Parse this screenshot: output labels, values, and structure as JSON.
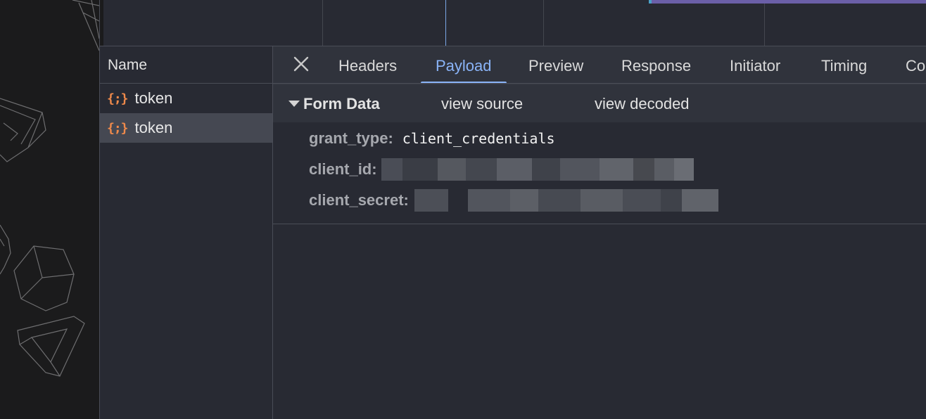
{
  "network": {
    "name_column_header": "Name",
    "requests": [
      {
        "icon": "json-braces-icon",
        "glyph": "{;}",
        "name": "token",
        "selected": false
      },
      {
        "icon": "json-braces-icon",
        "glyph": "{;}",
        "name": "token",
        "selected": true
      }
    ]
  },
  "detail": {
    "tabs": [
      {
        "label": "Headers",
        "active": false
      },
      {
        "label": "Payload",
        "active": true
      },
      {
        "label": "Preview",
        "active": false
      },
      {
        "label": "Response",
        "active": false
      },
      {
        "label": "Initiator",
        "active": false
      },
      {
        "label": "Timing",
        "active": false
      },
      {
        "label": "Co",
        "active": false
      }
    ],
    "close_icon": "close-icon",
    "form_data": {
      "title": "Form Data",
      "view_source": "view source",
      "view_decoded": "view decoded",
      "fields": [
        {
          "key": "grant_type:",
          "value": "client_credentials",
          "redacted": false
        },
        {
          "key": "client_id:",
          "value": "",
          "redacted": true
        },
        {
          "key": "client_secret:",
          "value": "",
          "redacted": true
        }
      ]
    }
  },
  "colors": {
    "accent": "#8ab4f8",
    "json_icon": "#f08a4b",
    "panel_bg": "#282a33",
    "selected_row": "#454852"
  }
}
